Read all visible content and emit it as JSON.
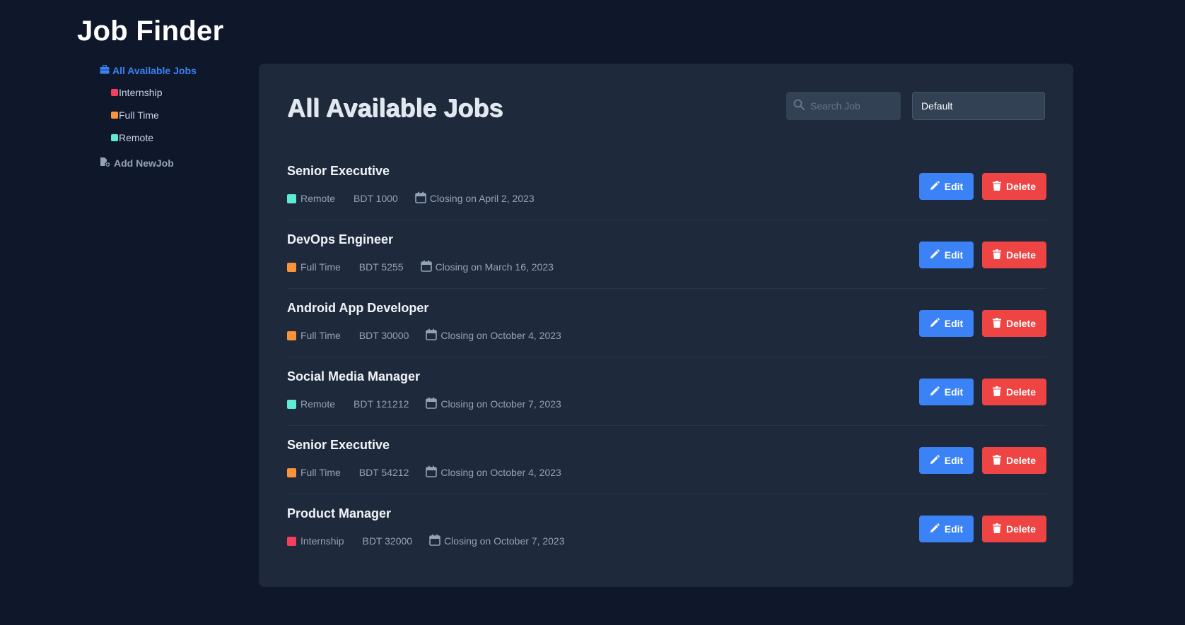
{
  "app": {
    "title": "Job Finder"
  },
  "colors": {
    "internship": "#f43f5e",
    "full_time": "#fb923c",
    "remote": "#5eead4",
    "accent": "#3b82f6",
    "danger": "#ef4444"
  },
  "sidebar": {
    "all_jobs": "All Available Jobs",
    "items": [
      {
        "label": "Internship",
        "type": "internship"
      },
      {
        "label": "Full Time",
        "type": "full_time"
      },
      {
        "label": "Remote",
        "type": "remote"
      }
    ],
    "add_job": "Add NewJob"
  },
  "main": {
    "title": "All Available Jobs",
    "search_placeholder": "Search Job",
    "sort_value": "Default",
    "edit_label": "Edit",
    "delete_label": "Delete",
    "jobs": [
      {
        "title": "Senior Executive",
        "type_label": "Remote",
        "type": "remote",
        "salary": "BDT 1000",
        "closing": "Closing on April 2, 2023"
      },
      {
        "title": "DevOps Engineer",
        "type_label": "Full Time",
        "type": "full_time",
        "salary": "BDT 5255",
        "closing": "Closing on March 16, 2023"
      },
      {
        "title": "Android App Developer",
        "type_label": "Full Time",
        "type": "full_time",
        "salary": "BDT 30000",
        "closing": "Closing on October 4, 2023"
      },
      {
        "title": "Social Media Manager",
        "type_label": "Remote",
        "type": "remote",
        "salary": "BDT 121212",
        "closing": "Closing on October 7, 2023"
      },
      {
        "title": "Senior Executive",
        "type_label": "Full Time",
        "type": "full_time",
        "salary": "BDT 54212",
        "closing": "Closing on October 4, 2023"
      },
      {
        "title": "Product Manager",
        "type_label": "Internship",
        "type": "internship",
        "salary": "BDT 32000",
        "closing": "Closing on October 7, 2023"
      }
    ]
  }
}
